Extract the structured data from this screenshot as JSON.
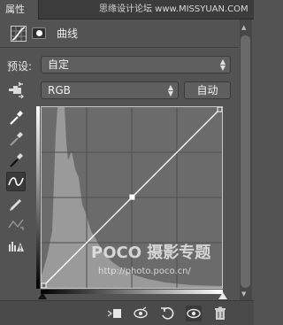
{
  "tab": {
    "label": "属性"
  },
  "watermark": "思缘设计论坛 www.MISSYUAN.COM",
  "header": {
    "title": "曲线"
  },
  "preset": {
    "label": "预设:",
    "value": "自定"
  },
  "channel": {
    "value": "RGB",
    "auto_label": "自动"
  },
  "graph_overlay": {
    "brand": "POCO 摄影专题",
    "url": "http://photo.poco.cn/"
  },
  "tools": [
    {
      "name": "hand-adjust-icon"
    },
    {
      "name": "white-point-eyedropper-icon"
    },
    {
      "name": "gray-point-eyedropper-icon"
    },
    {
      "name": "black-point-eyedropper-icon"
    },
    {
      "name": "curve-points-icon",
      "active": true
    },
    {
      "name": "pencil-draw-icon"
    },
    {
      "name": "smooth-curve-icon"
    },
    {
      "name": "clipping-warning-icon"
    }
  ],
  "curve": {
    "input_range": [
      0,
      255
    ],
    "output_range": [
      0,
      255
    ],
    "points": [
      [
        0,
        0
      ],
      [
        128,
        128
      ],
      [
        255,
        255
      ]
    ]
  },
  "bottom_icons": [
    "clip-to-layer-icon",
    "view-previous-state-icon",
    "reset-icon",
    "visibility-icon",
    "delete-icon"
  ]
}
